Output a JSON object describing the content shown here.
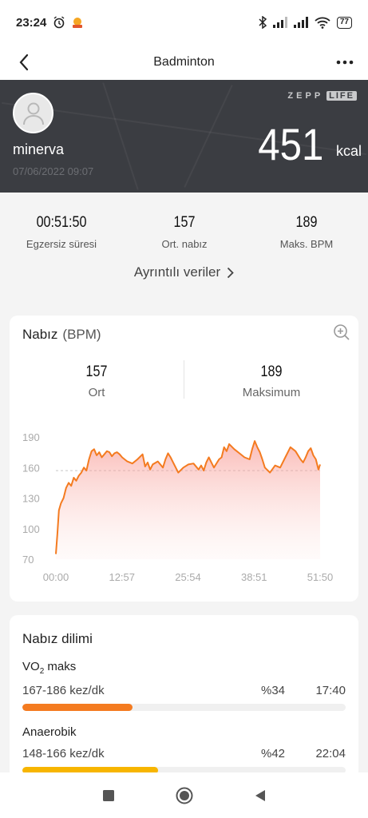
{
  "status_bar": {
    "time": "23:24",
    "battery": "77"
  },
  "nav": {
    "title": "Badminton"
  },
  "hero": {
    "brand_text": "ZEPP",
    "brand_badge": "LIFE",
    "username": "minerva",
    "date": "07/06/2022 09:07",
    "calories": "451",
    "calories_unit": "kcal"
  },
  "summary": {
    "stats": [
      {
        "value": "00:51:50",
        "label": "Egzersiz süresi"
      },
      {
        "value": "157",
        "label": "Ort. nabız"
      },
      {
        "value": "189",
        "label": "Maks. BPM"
      }
    ],
    "details_link": "Ayrıntılı veriler"
  },
  "heart_rate": {
    "title": "Nabız",
    "unit": "(BPM)",
    "avg_value": "157",
    "avg_label": "Ort",
    "max_value": "189",
    "max_label": "Maksimum"
  },
  "chart_data": {
    "type": "area",
    "title": "Nabız (BPM)",
    "x_tick_labels": [
      "00:00",
      "12:57",
      "25:54",
      "38:51",
      "51:50"
    ],
    "y_tick_labels": [
      "190",
      "160",
      "130",
      "100",
      "70"
    ],
    "ylim": [
      70,
      190
    ],
    "xlim_minutes": [
      0,
      51.83
    ],
    "average_line": 157,
    "series": [
      {
        "x": [
          0,
          0.3,
          0.6,
          1.0,
          1.5,
          2.0,
          2.5,
          3.0,
          3.5,
          4.0,
          4.5,
          5.0,
          5.5,
          6.0,
          6.5,
          7.0,
          7.5,
          8.0,
          8.5,
          9.0,
          9.5,
          10.0,
          10.5,
          11.0,
          11.5,
          12.0,
          12.5,
          13.0,
          14.0,
          15.0,
          16.0,
          17.0,
          17.5,
          18.0,
          18.5,
          19.0,
          20.0,
          21.0,
          21.5,
          22.0,
          22.5,
          23.0,
          24.0,
          25.0,
          26.0,
          27.0,
          28.0,
          28.5,
          29.0,
          29.5,
          30.0,
          30.5,
          31.0,
          32.0,
          32.5,
          33.0,
          33.5,
          34.0,
          35.0,
          36.0,
          37.0,
          38.0,
          38.5,
          39.0,
          39.5,
          40.0,
          40.5,
          41.0,
          42.0,
          43.0,
          44.0,
          45.0,
          46.0,
          47.0,
          48.0,
          48.5,
          49.0,
          49.5,
          50.0,
          50.5,
          51.0,
          51.5,
          51.83
        ],
        "values": [
          75,
          95,
          118,
          125,
          130,
          140,
          145,
          142,
          150,
          147,
          152,
          155,
          160,
          157,
          168,
          176,
          178,
          172,
          175,
          170,
          173,
          176,
          175,
          171,
          174,
          175,
          173,
          170,
          166,
          164,
          168,
          173,
          161,
          165,
          158,
          163,
          166,
          160,
          168,
          174,
          170,
          165,
          155,
          160,
          163,
          164,
          158,
          162,
          157,
          165,
          170,
          165,
          160,
          168,
          170,
          180,
          176,
          183,
          178,
          174,
          170,
          168,
          178,
          186,
          180,
          175,
          168,
          160,
          155,
          162,
          160,
          170,
          180,
          176,
          168,
          165,
          170,
          176,
          179,
          172,
          168,
          158,
          163
        ]
      }
    ],
    "colors": {
      "line": "#f47b20",
      "area_top": "#f47b20"
    }
  },
  "zones": {
    "title": "Nabız dilimi",
    "items": [
      {
        "name": "VO",
        "name_sub": "2",
        "name_rest": " maks",
        "range": "167-186 kez/dk",
        "percent": "%34",
        "duration": "17:40",
        "fraction": 0.34,
        "color": "#f47b20"
      },
      {
        "name": "Anaerobik",
        "name_sub": "",
        "name_rest": "",
        "range": "148-166 kez/dk",
        "percent": "%42",
        "duration": "22:04",
        "fraction": 0.42,
        "color": "#f7b500"
      }
    ]
  }
}
